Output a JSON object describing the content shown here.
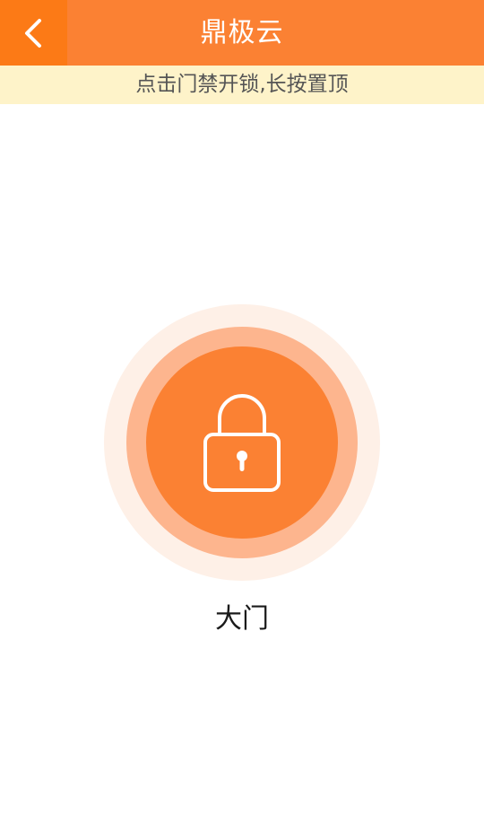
{
  "header": {
    "title": "鼎极云",
    "back_icon": "chevron-left-icon"
  },
  "hint": {
    "text": "点击门禁开锁,长按置顶"
  },
  "door": {
    "name": "大门",
    "icon": "lock-icon"
  },
  "colors": {
    "accent": "#FB8133",
    "back_bg": "#FC7A16",
    "hint_bg": "#FEF3C9",
    "ring_outer": "#FEF0E7",
    "ring_mid": "#FDB58E"
  }
}
